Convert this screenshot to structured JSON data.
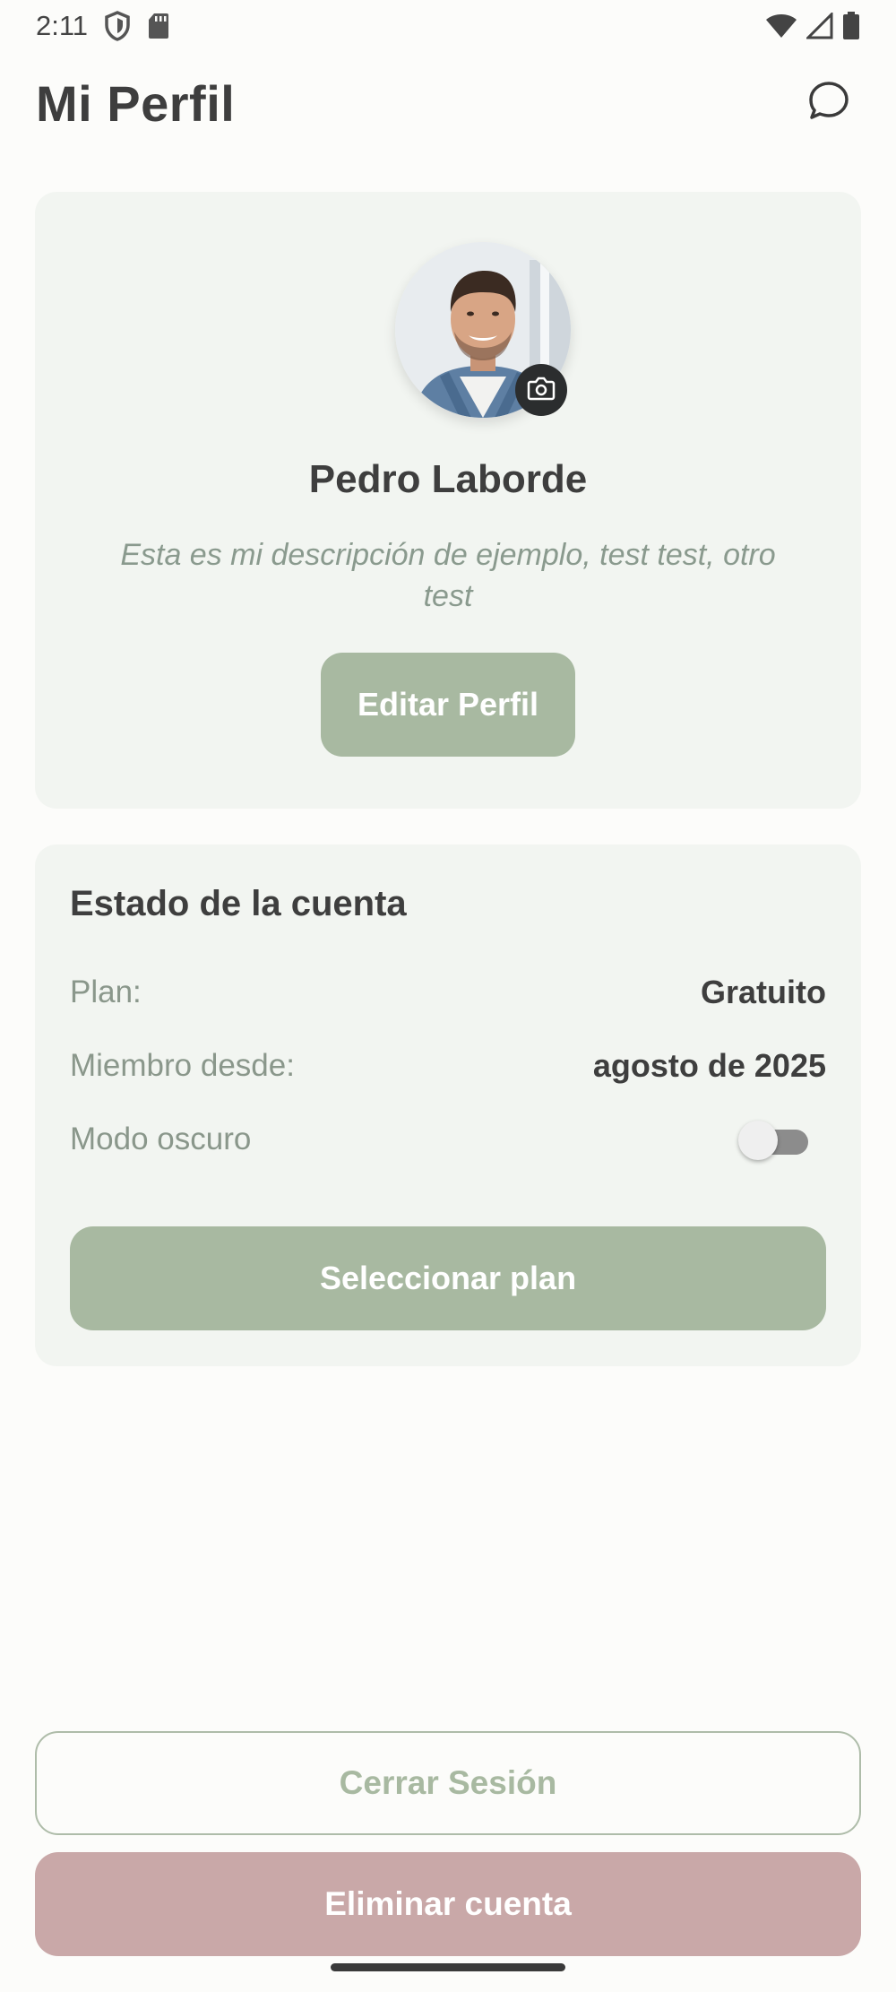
{
  "status_bar": {
    "time": "2:11",
    "icons": [
      "shield-icon",
      "sd-card-icon",
      "wifi-icon",
      "signal-icon",
      "battery-icon"
    ]
  },
  "header": {
    "title": "Mi Perfil",
    "chat_icon": "chat-bubble-icon"
  },
  "profile": {
    "name": "Pedro Laborde",
    "description": "Esta es mi descripción de ejemplo, test test, otro test",
    "edit_button": "Editar Perfil",
    "camera_icon": "camera-icon"
  },
  "account": {
    "title": "Estado de la cuenta",
    "plan_label": "Plan:",
    "plan_value": "Gratuito",
    "member_label": "Miembro desde:",
    "member_value": "agosto de 2025",
    "dark_mode_label": "Modo oscuro",
    "dark_mode_on": false,
    "select_plan_button": "Seleccionar plan"
  },
  "actions": {
    "logout_button": "Cerrar Sesión",
    "delete_button": "Eliminar cuenta"
  },
  "colors": {
    "accent": "#a8b9a1",
    "danger": "#c9a8a8",
    "card_bg": "#f2f5f1",
    "page_bg": "#fcfcfa"
  }
}
